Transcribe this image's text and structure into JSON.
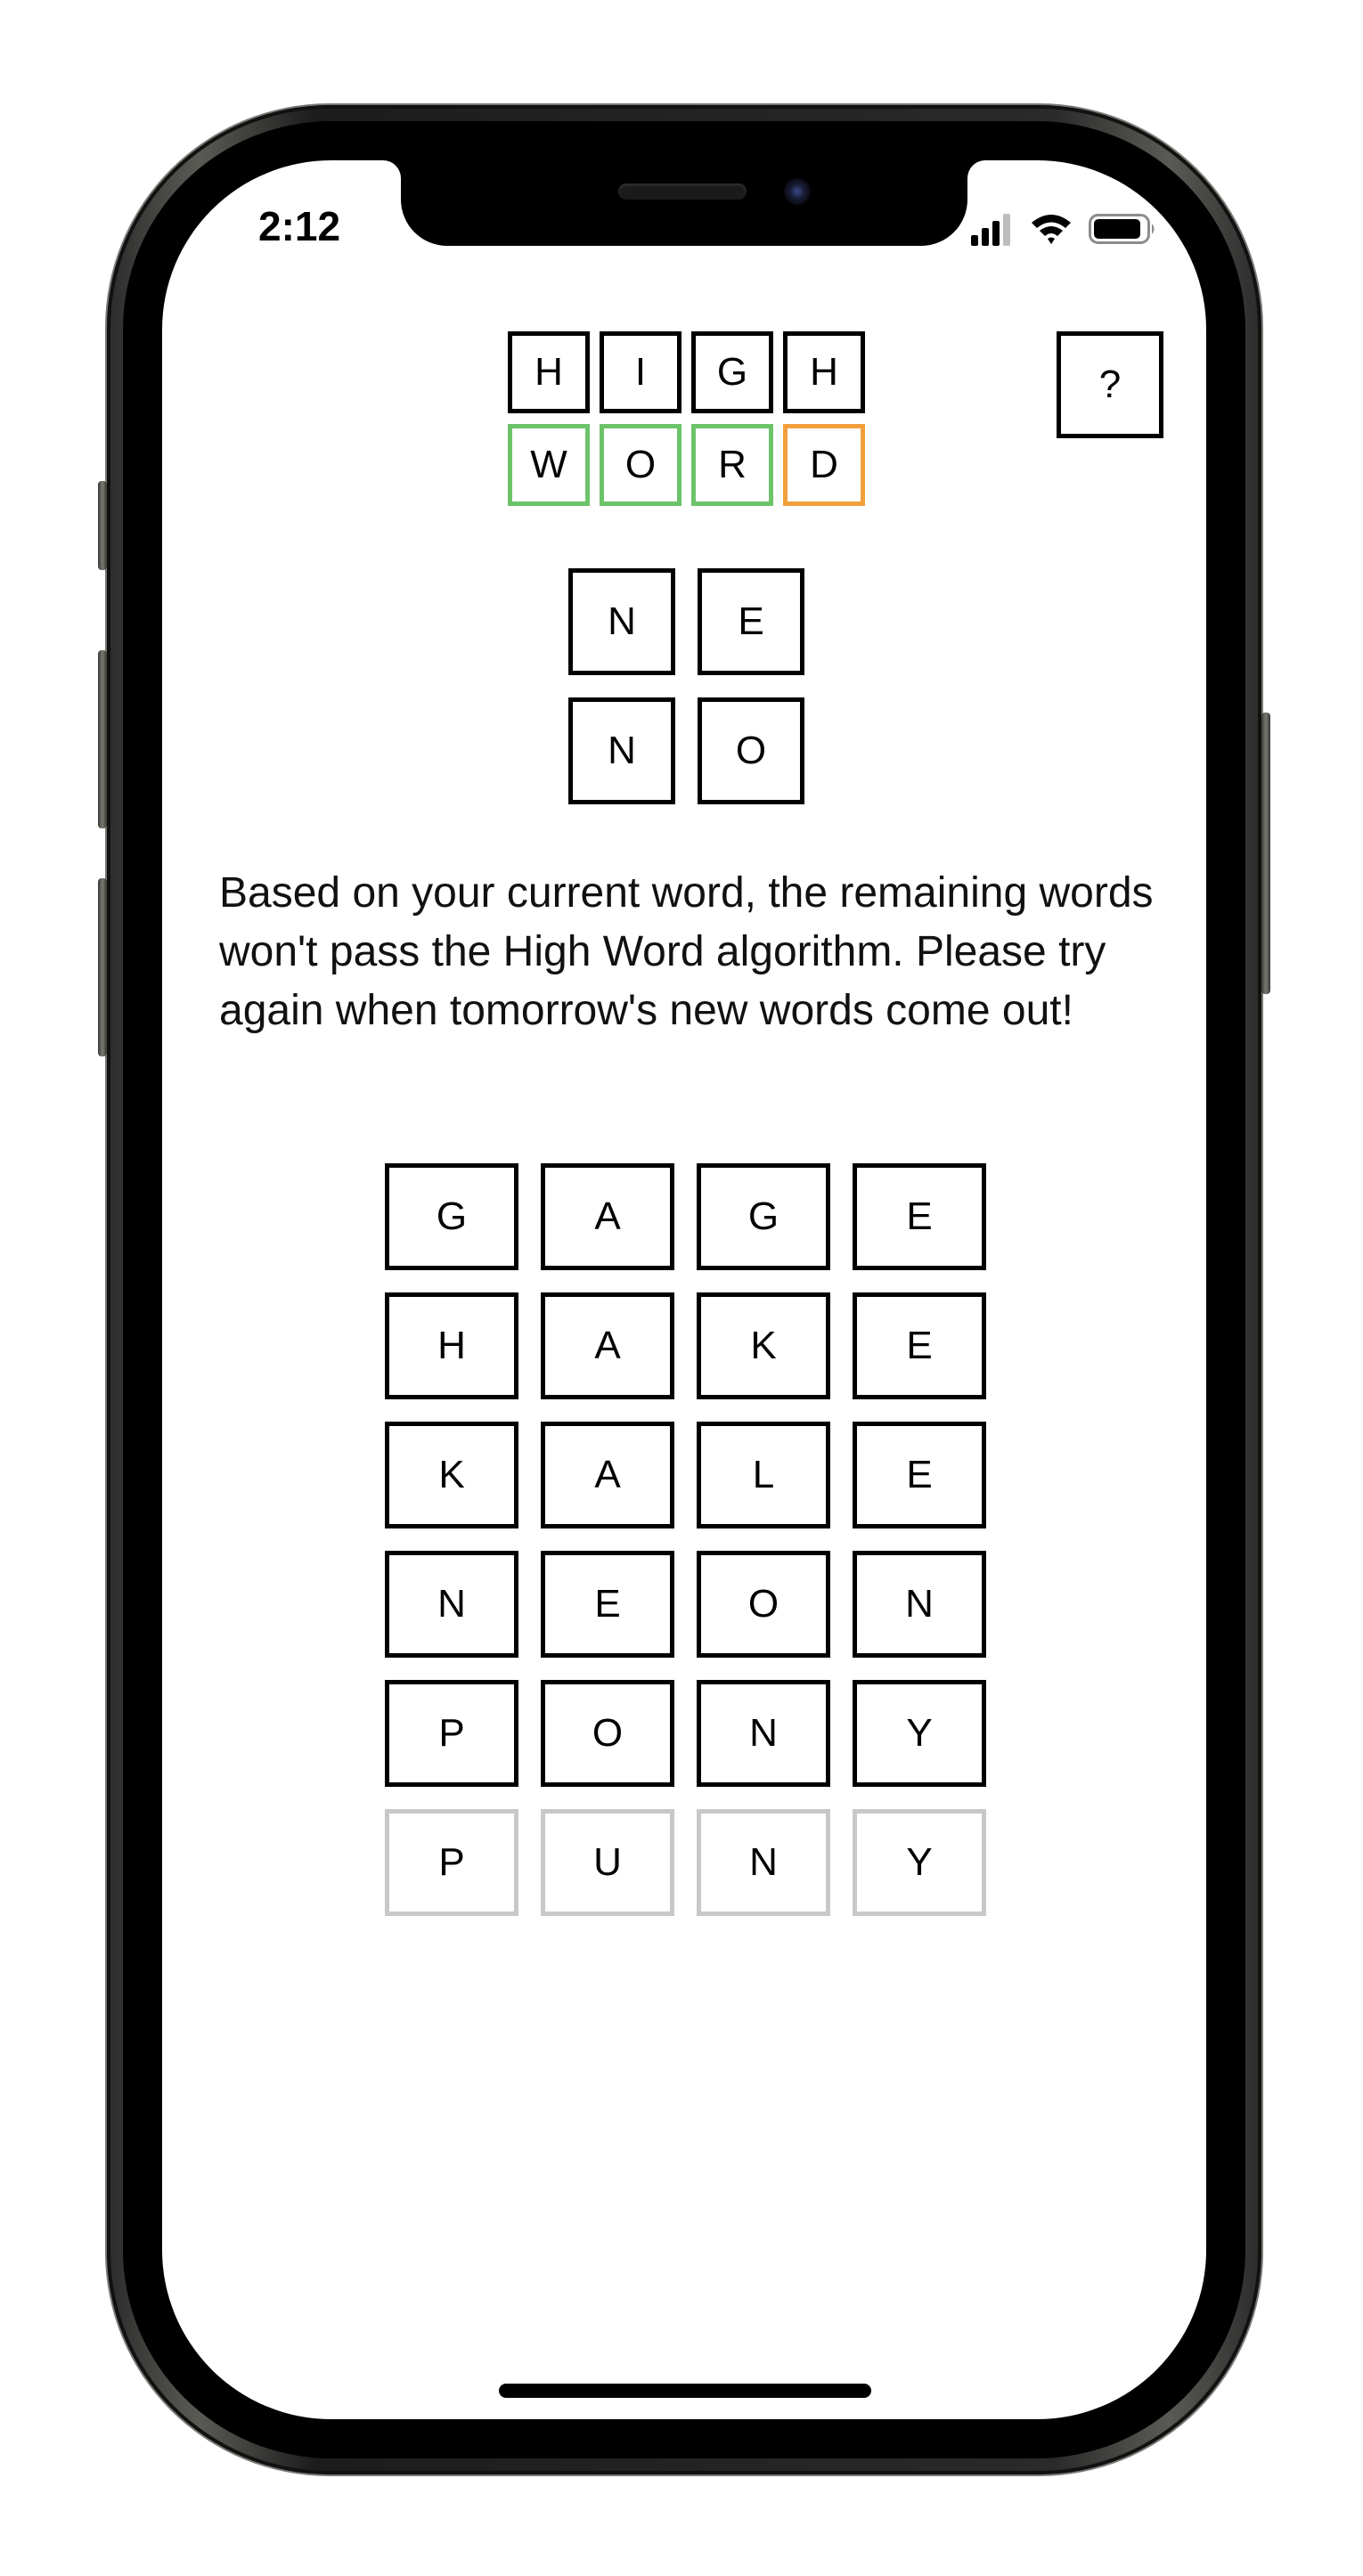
{
  "status_bar": {
    "time": "2:12",
    "icons": [
      "cellular-signal-icon",
      "wifi-icon",
      "battery-icon"
    ]
  },
  "logo": {
    "row1": [
      "H",
      "I",
      "G",
      "H"
    ],
    "row2": [
      "W",
      "O",
      "R",
      "D"
    ]
  },
  "help_label": "?",
  "current_word": [
    "N",
    "E",
    "N",
    "O"
  ],
  "message": "Based on your current word, the remaining words won't pass the High Word algorithm. Please try again when tomorrow's new words come out!",
  "word_list": [
    [
      "G",
      "A",
      "G",
      "E"
    ],
    [
      "H",
      "A",
      "K",
      "E"
    ],
    [
      "K",
      "A",
      "L",
      "E"
    ],
    [
      "N",
      "E",
      "O",
      "N"
    ],
    [
      "P",
      "O",
      "N",
      "Y"
    ],
    [
      "P",
      "U",
      "N",
      "Y"
    ]
  ],
  "colors": {
    "correct": "#6cc36a",
    "present": "#f2a03d",
    "inactive": "#c8c8c8",
    "tile_border": "#000000"
  }
}
